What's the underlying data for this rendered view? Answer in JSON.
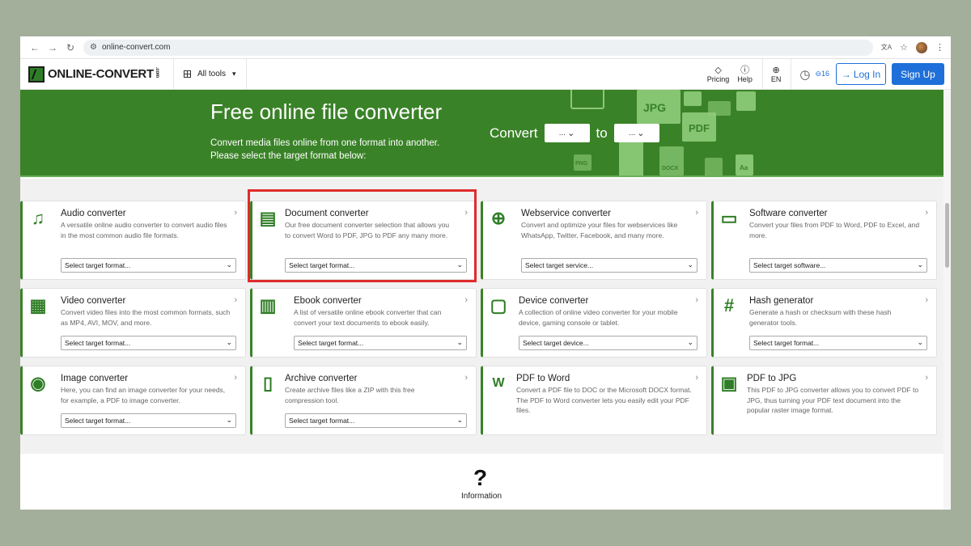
{
  "browser": {
    "url": "online-convert.com",
    "back": "←",
    "forward": "→",
    "reload": "↻",
    "star": "☆",
    "menu": "⋮",
    "translate": "文A"
  },
  "header": {
    "logo_text": "ONLINE-CONVERT",
    "logo_domain": ".com",
    "all_tools": "All tools",
    "pricing": "Pricing",
    "help": "Help",
    "lang": "EN",
    "credits": "16",
    "login": "Log In",
    "signup": "Sign Up"
  },
  "hero": {
    "title": "Free online file converter",
    "subtitle": "Convert media files online from one format into another. Please select the target format below:",
    "convert_label": "Convert",
    "to_label": "to",
    "from_value": "...",
    "to_value": "..."
  },
  "cards": [
    {
      "title": "Audio converter",
      "desc": "A versatile online audio converter to convert audio files in the most common audio file formats.",
      "select": "Select target format...",
      "icon": "music-note-icon"
    },
    {
      "title": "Document converter",
      "desc": "Our free document converter selection that allows you to convert Word to PDF, JPG to PDF any many more.",
      "select": "Select target format...",
      "icon": "document-icon"
    },
    {
      "title": "Webservice converter",
      "desc": "Convert and optimize your files for webservices like WhatsApp, Twitter, Facebook, and many more.",
      "select": "Select target service...",
      "icon": "globe-icon"
    },
    {
      "title": "Software converter",
      "desc": "Convert your files from PDF to Word, PDF to Excel, and more.",
      "select": "Select target software...",
      "icon": "monitor-icon"
    },
    {
      "title": "Video converter",
      "desc": "Convert video files into the most common formats, such as MP4, AVI, MOV, and more.",
      "select": "Select target format...",
      "icon": "film-icon"
    },
    {
      "title": "Ebook converter",
      "desc": "A list of versatile online ebook converter that can convert your text documents to ebook easily.",
      "select": "Select target format...",
      "icon": "books-icon"
    },
    {
      "title": "Device converter",
      "desc": "A collection of online video converter for your mobile device, gaming console or tablet.",
      "select": "Select target device...",
      "icon": "tablet-icon"
    },
    {
      "title": "Hash generator",
      "desc": "Generate a hash or checksum with these hash generator tools.",
      "select": "Select target format...",
      "icon": "hash-icon"
    },
    {
      "title": "Image converter",
      "desc": "Here, you can find an image converter for your needs, for example, a PDF to image converter.",
      "select": "Select target format...",
      "icon": "camera-icon"
    },
    {
      "title": "Archive converter",
      "desc": "Create archive files like a ZIP with this free compression tool.",
      "select": "Select target format...",
      "icon": "archive-icon"
    },
    {
      "title": "PDF to Word",
      "desc": "Convert a PDF file to DOC or the Microsoft DOCX format. The PDF to Word converter lets you easily edit your PDF files.",
      "select": "",
      "icon": "word-icon"
    },
    {
      "title": "PDF to JPG",
      "desc": "This PDF to JPG converter allows you to convert PDF to JPG, thus turning your PDF text document into the popular raster image format.",
      "select": "",
      "icon": "image-icon"
    }
  ],
  "hero_icons": {
    "jpg": "JPG",
    "pdf": "PDF",
    "docx": "DOCX",
    "png": "PNG",
    "aa": "Aa"
  },
  "info": {
    "label": "Information",
    "glyph": "?"
  },
  "colors": {
    "brand_green": "#3a8228",
    "accent_blue": "#1e6fd9",
    "highlight_red": "#e02b2b"
  }
}
